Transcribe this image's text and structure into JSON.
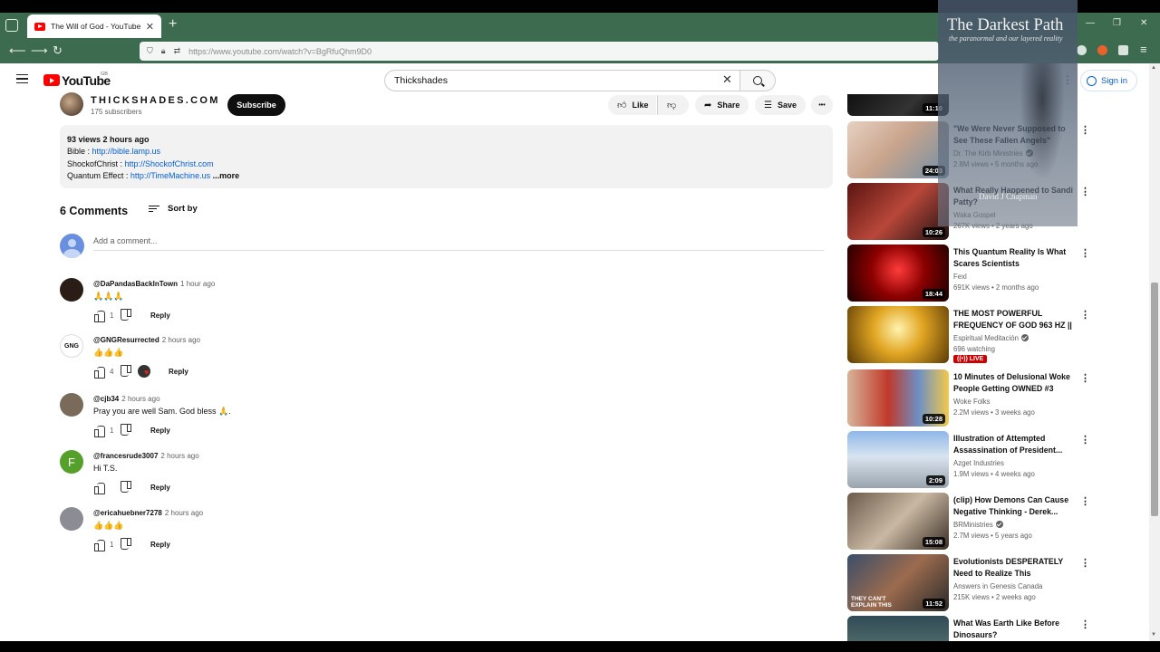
{
  "browser": {
    "tab_title": "The Will of God - YouTube",
    "tab_close": "✕",
    "new_tab": "+",
    "url": "https://www.youtube.com/watch?v=BgRfuQhm9D0",
    "controls": {
      "minimize": "—",
      "restore": "❐",
      "close": "✕"
    }
  },
  "header": {
    "logo_text": "YouTube",
    "region": "GB",
    "search_value": "Thickshades",
    "clear_glyph": "✕",
    "signin_label": "Sign in"
  },
  "channel": {
    "name": "THICKSHADES.COM",
    "subscribers": "175 subscribers",
    "subscribe_label": "Subscribe"
  },
  "actions": {
    "like_label": "Like",
    "share_label": "Share",
    "save_label": "Save",
    "more_glyph": "•••"
  },
  "description": {
    "stats": "93 views  2 hours ago",
    "line1_label": "Bible : ",
    "line1_link": "http://bible.lamp.us",
    "line2_label": "ShockofChrist : ",
    "line2_link": "http://ShockofChrist.com",
    "line3_label": "Quantum Effect : ",
    "line3_link": "http://TimeMachine.us",
    "more": "...more"
  },
  "comments": {
    "count_label": "6 Comments",
    "sort_label": "Sort by",
    "add_placeholder": "Add a comment...",
    "reply_label": "Reply",
    "items": [
      {
        "author": "@DaPandasBackInTown",
        "time": "1 hour ago",
        "text": "🙏🙏🙏",
        "likes": "1",
        "avatar_color": "#2a1c17",
        "avatar_letter": ""
      },
      {
        "author": "@GNGResurrected",
        "time": "2 hours ago",
        "text": "👍👍👍",
        "likes": "4",
        "avatar_color": "#ffffff",
        "avatar_letter": "GNG"
      },
      {
        "author": "@cjb34",
        "time": "2 hours ago",
        "text": "Pray you are well Sam. God bless 🙏.",
        "likes": "1",
        "avatar_color": "#7a6a5a",
        "avatar_letter": ""
      },
      {
        "author": "@francesrude3007",
        "time": "2 hours ago",
        "text": "Hi T.S.",
        "likes": "",
        "avatar_color": "#54a02b",
        "avatar_letter": "F"
      },
      {
        "author": "@ericahuebner7278",
        "time": "2 hours ago",
        "text": "👍👍👍",
        "likes": "1",
        "avatar_color": "#8c8c94",
        "avatar_letter": ""
      }
    ]
  },
  "sidebar": {
    "kebab": "⋮",
    "videos": [
      {
        "title": "",
        "channel": "",
        "meta": "",
        "duration": "11:10",
        "verified": false,
        "live": false,
        "thumb": "linear-gradient(135deg,#111,#333 60%,#000)"
      },
      {
        "title": "\"We Were Never Supposed to See These Fallen Angels\"",
        "channel": "Dr. The Kirb Ministries",
        "meta": "2.8M views  •  5 months ago",
        "duration": "24:03",
        "verified": true,
        "live": false,
        "thumb": "linear-gradient(135deg,#e7d1c2,#c9a48c 45%,#6e8fa8)"
      },
      {
        "title": "What Really Happened to Sandi Patty?",
        "channel": "Waka Gospel",
        "meta": "267K views  •  2 years ago",
        "duration": "10:26",
        "verified": false,
        "live": false,
        "thumb": "linear-gradient(135deg,#5a1410,#b8473a 50%,#1e1010)"
      },
      {
        "title": "This Quantum Reality Is What Scares Scientists",
        "channel": "Fexl",
        "meta": "691K views  •  2 months ago",
        "duration": "18:44",
        "verified": false,
        "live": false,
        "thumb": "radial-gradient(circle at 50% 45%,#ff3b3b,#8b0000 45%,#1a0000)"
      },
      {
        "title": "THE MOST POWERFUL FREQUENCY OF GOD 963 HZ || ...",
        "channel": "Espiritual Meditación",
        "meta": "696 watching",
        "duration": "",
        "verified": true,
        "live": true,
        "thumb": "radial-gradient(circle at 50% 40%,#fff3b0,#e2a623 40%,#5a3a05)"
      },
      {
        "title": "10 Minutes of Delusional Woke People Getting OWNED #3",
        "channel": "Woke Folks",
        "meta": "2.2M views  •  3 weeks ago",
        "duration": "10:28",
        "verified": false,
        "live": false,
        "thumb": "linear-gradient(90deg,#d8b49a,#c0392b 40%,#6d8fc4 70%,#f2c94c)"
      },
      {
        "title": "Illustration of Attempted Assassination of President...",
        "channel": "Azget Industries",
        "meta": "1.9M views  •  4 weeks ago",
        "duration": "2:09",
        "verified": false,
        "live": false,
        "thumb": "linear-gradient(180deg,#8fb7e8,#d8e4f0 45%,#9aa3ad)"
      },
      {
        "title": "(clip) How Demons Can Cause Negative Thinking - Derek...",
        "channel": "BRMinistries",
        "meta": "2.7M views  •  5 years ago",
        "duration": "15:08",
        "verified": true,
        "live": false,
        "thumb": "linear-gradient(135deg,#6b5a4a,#c9b8a3 50%,#3a2e24)"
      },
      {
        "title": "Evolutionists DESPERATELY Need to Realize This",
        "channel": "Answers in Genesis Canada",
        "meta": "215K views  •  2 weeks ago",
        "duration": "11:52",
        "verified": false,
        "live": false,
        "thumb": "linear-gradient(135deg,#3a4e6a,#9c6b4e 50%,#2a2a2a)"
      },
      {
        "title": "What Was Earth Like Before Dinosaurs?",
        "channel": "",
        "meta": "",
        "duration": "",
        "verified": false,
        "live": false,
        "thumb": "linear-gradient(180deg,#2f4a55,#6f8a7d)"
      }
    ],
    "live_label": "LIVE",
    "thumb_caption": "THEY CAN'T EXPLAIN THIS"
  },
  "overlay": {
    "title": "The Darkest Path",
    "subtitle": "the paranormal and our layered reality",
    "author": "David J Chapman"
  }
}
